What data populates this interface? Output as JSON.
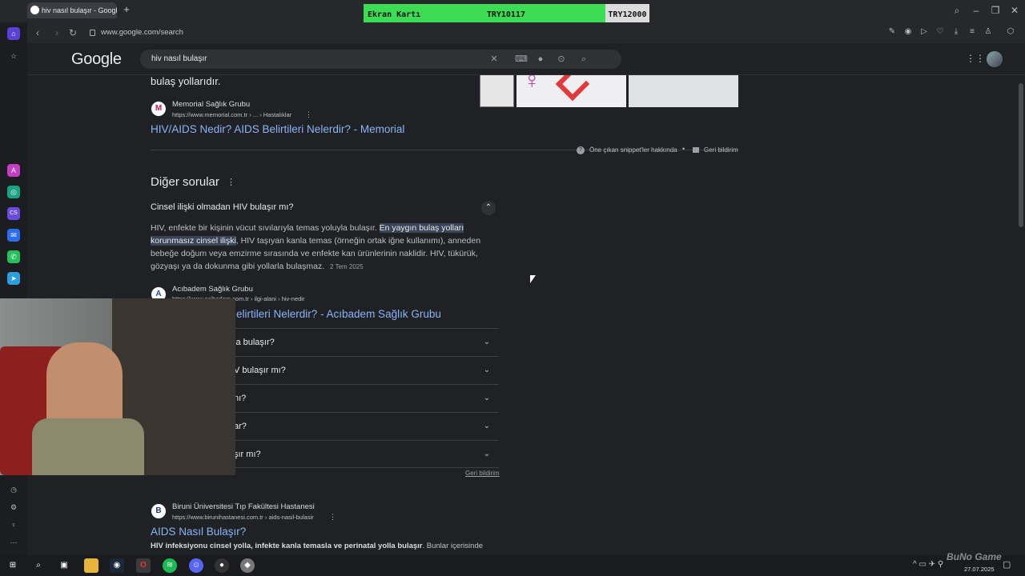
{
  "browser": {
    "tab_title": "hiv nasıl bulaşır - Google",
    "url": "www.google.com/search"
  },
  "price_overlay": {
    "label": "Ekran Kartı",
    "price1": "TRY10117",
    "price2": "TRY12000"
  },
  "google": {
    "logo": "Google",
    "query": "hiv nasıl bulaşır",
    "top_snippet_tail": "bulaş yollarıdır.",
    "result1": {
      "source_name": "Memorial Sağlık Grubu",
      "source_url": "https://www.memorial.com.tr › ... › Hastalıklar",
      "title": "HIV/AIDS Nedir? AIDS Belirtileri Nelerdir? - Memorial"
    },
    "snippet_about": "Öne çıkan snippet'ler hakkında",
    "feedback": "Geri bildirim",
    "other_questions_title": "Diğer sorular",
    "expanded_question": "Cinsel ilişki olmadan HIV bulaşır mı?",
    "answer_part1": "HIV, enfekte bir kişinin vücut sıvılarıyla temas yoluyla bulaşır. ",
    "answer_highlight": "En yaygın bulaş yolları korunmasız cinsel ilişki",
    "answer_part2": ", HIV taşıyan kanla temas (örneğin ortak iğne kullanımı), anneden bebeğe doğum veya emzirme sırasında ve enfekte kan ürünlerinin naklidir. HIV, tükürük, gözyaşı ya da dokunma gibi yollarla bulaşmaz.",
    "answer_date": "2 Tem 2025",
    "answer_source_name": "Acıbadem Sağlık Grubu",
    "answer_source_url": "https://www.acibadem.com.tr › ilgi-alani › hiv-nedir",
    "answer_link_visible": "elirtileri Nelerdir? - Acıbadem Sağlık Grubu",
    "collapsed_questions": [
      "la bulaşır?",
      "V bulaşır mı?",
      "nı?",
      "ar?",
      "şır mı?"
    ],
    "feedback_small": "Geri bildirim",
    "result2": {
      "source_name": "Biruni Üniversitesi Tıp Fakültesi Hastanesi",
      "source_url": "https://www.birunihastanesi.com.tr › aids-nasil-bulasir",
      "title": "AIDS Nasıl Bulaşır?",
      "snippet_bold": "HIV infeksiyonu cinsel yolla, infekte kanla temasla ve perinatal yolla bulaşır",
      "snippet_rest": ". Bunlar içerisinde"
    }
  },
  "taskbar": {
    "date": "27.07.2025"
  },
  "watermark": "BuNo Game"
}
